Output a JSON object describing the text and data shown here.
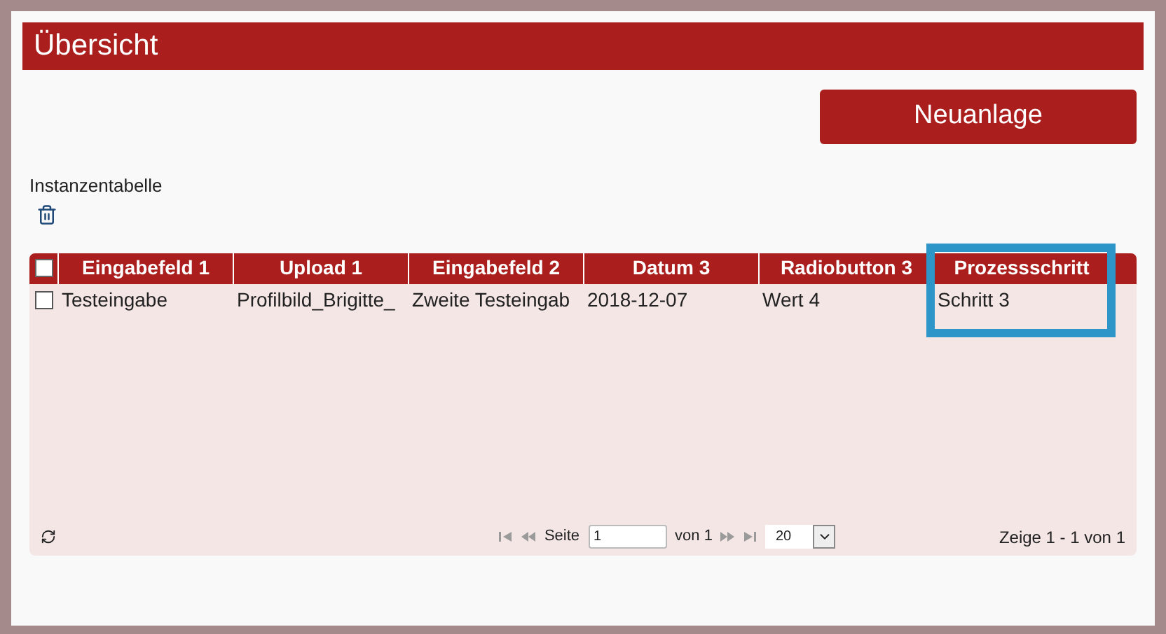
{
  "header": {
    "title": "Übersicht"
  },
  "new_button": {
    "label": "Neuanlage"
  },
  "table_title": "Instanzentabelle",
  "table": {
    "select_all_checked": false,
    "columns": [
      {
        "label": "Eingabefeld 1",
        "highlighted": false
      },
      {
        "label": "Upload 1",
        "highlighted": false
      },
      {
        "label": "Eingabefeld 2",
        "highlighted": false
      },
      {
        "label": "Datum 3",
        "highlighted": false
      },
      {
        "label": "Radiobutton 3",
        "highlighted": false
      },
      {
        "label": "Prozessschritt",
        "highlighted": true
      }
    ],
    "rows": [
      {
        "checked": false,
        "cells": [
          "Testeingabe",
          "Profilbild_Brigitte_",
          "Zweite Testeingab",
          "2018-12-07",
          "Wert 4",
          "Schritt 3"
        ]
      }
    ]
  },
  "pager": {
    "page_label": "Seite",
    "page_value": "1",
    "of_label": "von 1",
    "page_size": "20",
    "summary": "Zeige 1 - 1 von 1"
  }
}
